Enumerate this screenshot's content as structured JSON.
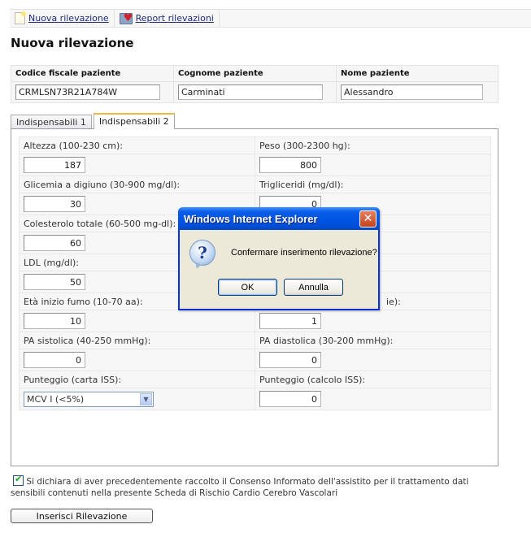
{
  "toolbar": {
    "items": [
      {
        "label": "Nuova rilevazione",
        "icon": "new-document-icon"
      },
      {
        "label": "Report rilevazioni",
        "icon": "report-folder-icon"
      }
    ]
  },
  "page_title": "Nuova rilevazione",
  "patient": {
    "headers": [
      "Codice fiscale paziente",
      "Cognome paziente",
      "Nome paziente"
    ],
    "values": [
      "CRMLSN73R21A784W",
      "Carminati",
      "Alessandro"
    ]
  },
  "tabs": [
    {
      "label": "Indispensabili 1",
      "active": false
    },
    {
      "label": "Indispensabili 2",
      "active": true
    }
  ],
  "fields": {
    "altezza": {
      "label": "Altezza (100-230 cm):",
      "value": "187"
    },
    "peso": {
      "label": "Peso (300-2300 hg):",
      "value": "800"
    },
    "glicemia": {
      "label": "Glicemia a digiuno (30-900 mg/dl):",
      "value": "30"
    },
    "trigliceridi": {
      "label": "Trigliceridi (mg/dl):",
      "value": "0"
    },
    "colesterolo": {
      "label": "Colesterolo totale (60-500 mg-dl):",
      "value": "60"
    },
    "hdl": {
      "label": "",
      "value": ""
    },
    "ldl": {
      "label": "LDL (mg/dl):",
      "value": "50"
    },
    "hidden_right": {
      "label": "",
      "value": ""
    },
    "fumo_inizio": {
      "label": "Età inizio fumo (10-70 aa):",
      "value": "10"
    },
    "fumo_right": {
      "label": "ie):",
      "value": "1"
    },
    "pa_sistolica": {
      "label": "PA sistolica (40-250 mmHg):",
      "value": "0"
    },
    "pa_diastolica": {
      "label": "PA diastolica (30-200 mmHg):",
      "value": "0"
    },
    "punteggio_carta": {
      "label": "Punteggio (carta ISS):",
      "value": "MCV I (<5%)"
    },
    "punteggio_calcolo": {
      "label": "Punteggio (calcolo ISS):",
      "value": "0"
    }
  },
  "consent": {
    "checked": true,
    "text": "Si dichiara di aver precedentemente raccolto il Consenso Informato dell'assistito per il trattamento dati sensibili contenuti nella presente Scheda di Rischio Cardio Cerebro Vascolari"
  },
  "submit_label": "Inserisci Rilevazione",
  "dialog": {
    "title": "Windows Internet Explorer",
    "message": "Confermare inserimento rilevazione?",
    "icon": "question-icon",
    "ok_label": "OK",
    "cancel_label": "Annulla",
    "close_glyph": "✕"
  }
}
